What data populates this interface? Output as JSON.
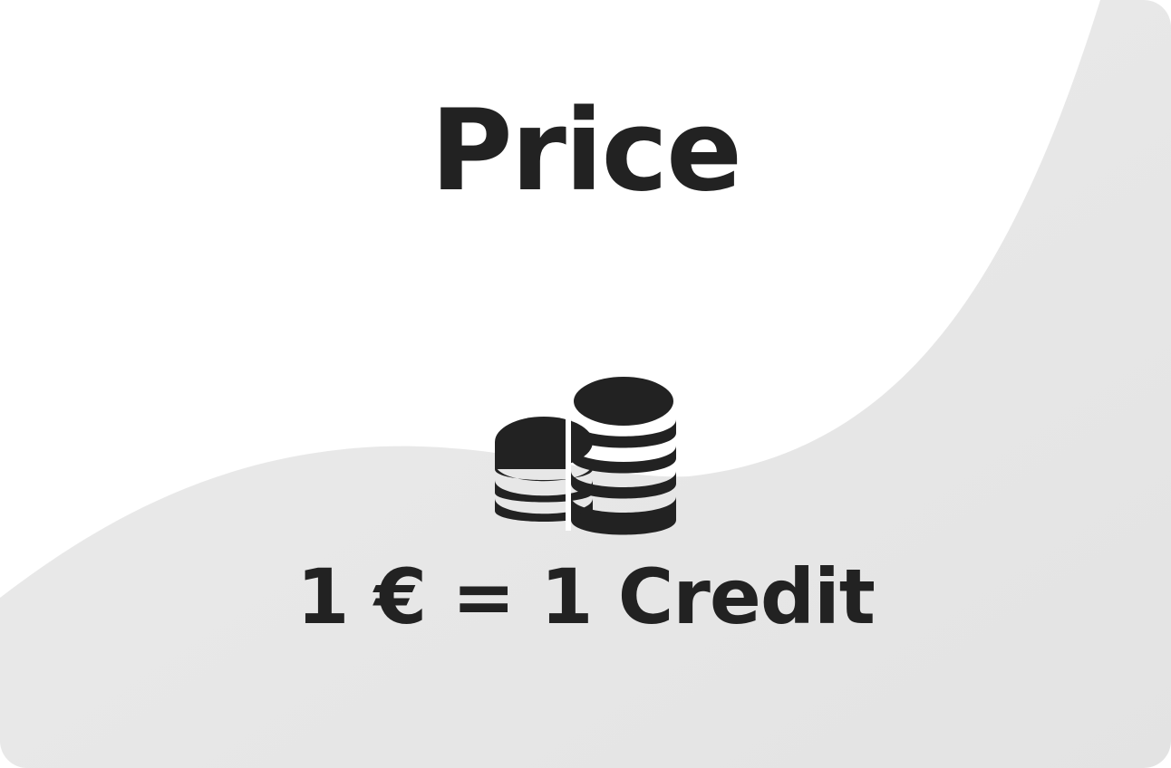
{
  "card": {
    "title": "Price",
    "icon": "coins-stack-icon",
    "rate": "1 € = 1 Credit"
  },
  "colors": {
    "text": "#222222",
    "background": "#ffffff",
    "shape": "#e6e6e6"
  }
}
